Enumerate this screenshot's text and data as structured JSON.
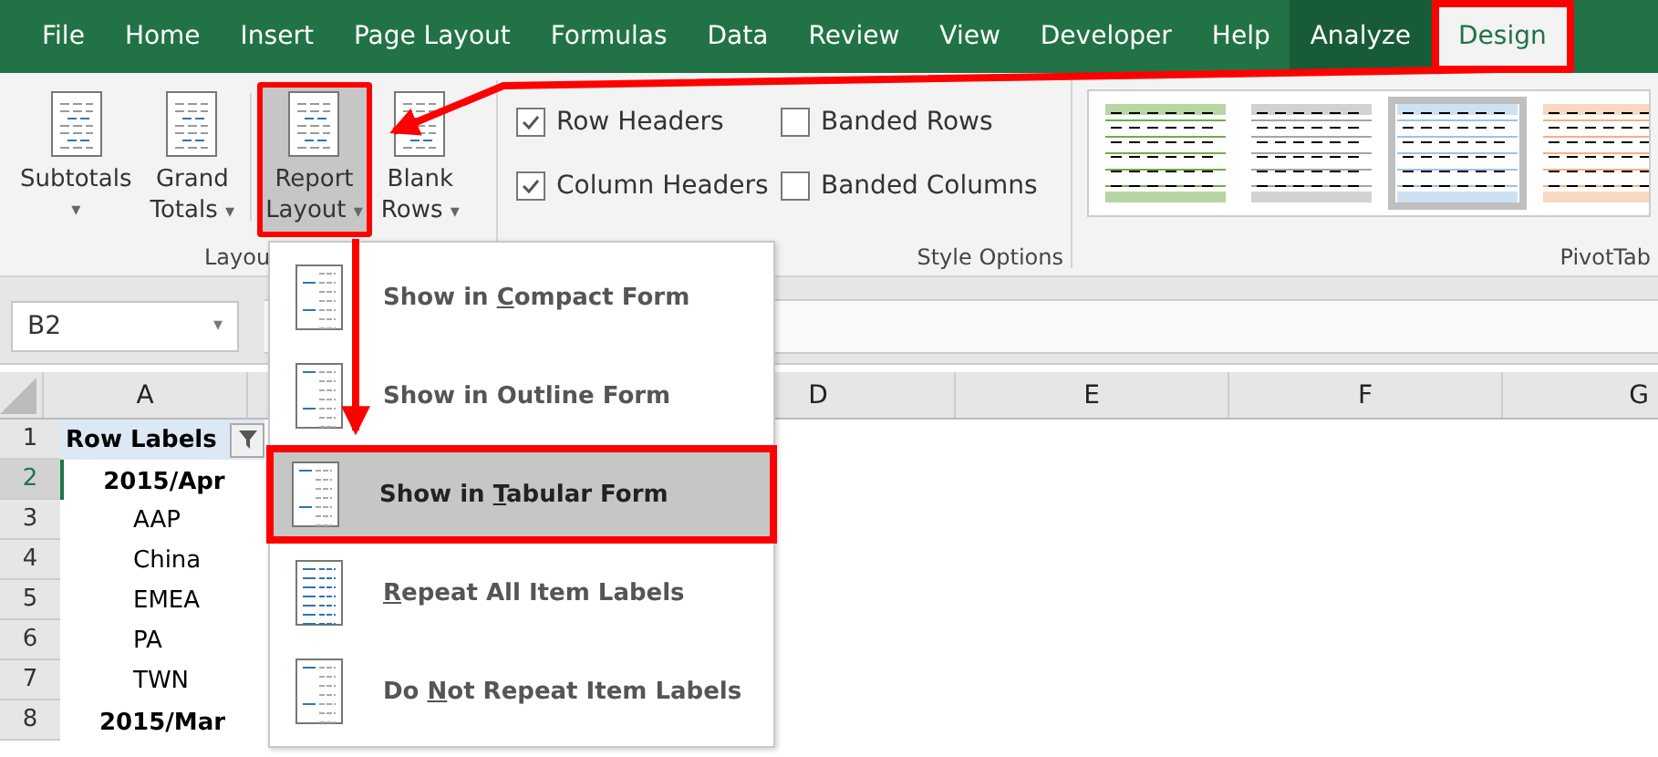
{
  "tabs": [
    {
      "label": "File",
      "selected": false,
      "kind": "menu",
      "highlighted": false
    },
    {
      "label": "Home",
      "selected": false,
      "kind": "menu",
      "highlighted": false
    },
    {
      "label": "Insert",
      "selected": false,
      "kind": "menu",
      "highlighted": false
    },
    {
      "label": "Page Layout",
      "selected": false,
      "kind": "menu",
      "highlighted": false
    },
    {
      "label": "Formulas",
      "selected": false,
      "kind": "menu",
      "highlighted": false
    },
    {
      "label": "Data",
      "selected": false,
      "kind": "menu",
      "highlighted": false
    },
    {
      "label": "Review",
      "selected": false,
      "kind": "menu",
      "highlighted": false
    },
    {
      "label": "View",
      "selected": false,
      "kind": "menu",
      "highlighted": false
    },
    {
      "label": "Developer",
      "selected": false,
      "kind": "menu",
      "highlighted": false
    },
    {
      "label": "Help",
      "selected": false,
      "kind": "menu",
      "highlighted": false
    },
    {
      "label": "Analyze",
      "selected": false,
      "kind": "context",
      "highlighted": false
    },
    {
      "label": "Design",
      "selected": true,
      "kind": "context",
      "highlighted": true
    }
  ],
  "ribbon": {
    "layout_group": {
      "label": "Layou",
      "buttons": [
        {
          "lines": [
            "Subtotals"
          ],
          "caret": "▾",
          "pressed": false,
          "highlighted": false
        },
        {
          "lines": [
            "Grand",
            "Totals"
          ],
          "caret": "▾",
          "pressed": false,
          "highlighted": false
        },
        {
          "lines": [
            "Report",
            "Layout"
          ],
          "caret": "▾",
          "pressed": true,
          "highlighted": true
        },
        {
          "lines": [
            "Blank",
            "Rows"
          ],
          "caret": "▾",
          "pressed": false,
          "highlighted": false
        }
      ]
    },
    "style_options": {
      "label": "Style Options",
      "checkboxes": [
        {
          "label": "Row Headers",
          "checked": true
        },
        {
          "label": "Banded Rows",
          "checked": false
        },
        {
          "label": "Column Headers",
          "checked": true
        },
        {
          "label": "Banded Columns",
          "checked": false
        }
      ]
    },
    "styles_group": {
      "label": "PivotTab",
      "styles": [
        {
          "color": "#70ad47",
          "selected": false
        },
        {
          "color": "#a5a5a5",
          "selected": false
        },
        {
          "color": "#9dc3e6",
          "selected": true
        },
        {
          "color": "#f4b183",
          "selected": false
        }
      ]
    }
  },
  "name_box": {
    "value": "B2",
    "caret": "▾"
  },
  "sheet": {
    "columns": [
      "A",
      "D",
      "E",
      "F",
      "G"
    ],
    "rows": [
      {
        "number": "1",
        "label": "Row Labels",
        "kind": "header",
        "selected": false
      },
      {
        "number": "2",
        "label": "2015/Apr",
        "kind": "group",
        "selected": true
      },
      {
        "number": "3",
        "label": "AAP",
        "kind": "item",
        "selected": false
      },
      {
        "number": "4",
        "label": "China",
        "kind": "item",
        "selected": false
      },
      {
        "number": "5",
        "label": "EMEA",
        "kind": "item",
        "selected": false
      },
      {
        "number": "6",
        "label": "PA",
        "kind": "item",
        "selected": false
      },
      {
        "number": "7",
        "label": "TWN",
        "kind": "item",
        "selected": false
      },
      {
        "number": "8",
        "label": "2015/Mar",
        "kind": "group",
        "selected": false
      }
    ]
  },
  "menu": {
    "items": [
      {
        "before": "Show in ",
        "key": "C",
        "after": "ompact Form",
        "kind": "compact",
        "selected": false
      },
      {
        "before": "Show in Outline Form",
        "kind": "outline",
        "selected": false
      },
      {
        "before": "Show in ",
        "key": "T",
        "after": "abular Form",
        "kind": "tabular",
        "selected": true
      },
      {
        "key": "R",
        "after": "epeat All Item Labels",
        "kind": "repeat",
        "selected": false
      },
      {
        "before": "Do ",
        "key": "N",
        "after": "ot Repeat Item Labels",
        "kind": "norepeat",
        "selected": false
      }
    ]
  }
}
